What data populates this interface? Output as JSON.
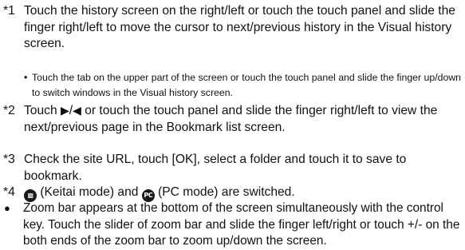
{
  "notes": [
    {
      "marker": "*1",
      "text": "Touch the history screen on the right/left or touch the touch panel and slide the finger right/left to move the cursor to next/previous history in the Visual history screen.",
      "sub": {
        "bullet": "•",
        "text": "Touch the tab on the upper part of the screen or touch the touch panel and slide the finger up/down to switch windows in the Visual history screen."
      }
    },
    {
      "marker": "*2",
      "text_before": "Touch ",
      "right_arrow": "▶",
      "separator": "/",
      "left_arrow": "◀",
      "text_after": " or touch the touch panel and slide the finger right/left to view the next/previous page in the Bookmark list screen."
    },
    {
      "marker": "*3",
      "text": "Check the site URL, touch [OK], select a folder and touch it to save to bookmark."
    },
    {
      "marker": "*4",
      "icon_keitai": "keitai-mode-icon",
      "text_keitai": " (Keitai mode) and ",
      "icon_pc": "pc-mode-icon",
      "icon_pc_glyph": "PC",
      "text_pc": " (PC mode) are switched."
    }
  ],
  "zoom_note": {
    "bullet": "●",
    "text": "Zoom bar appears at the bottom of the screen simultaneously with the control key. Touch the slider of zoom bar and slide the finger left/right or touch +/- on the both ends of the zoom bar to zoom up/down the screen."
  }
}
